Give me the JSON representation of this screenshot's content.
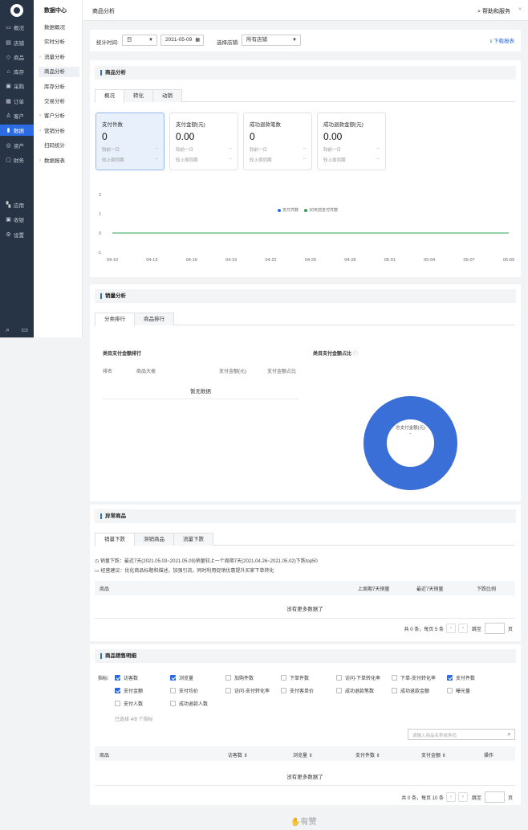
{
  "rail": {
    "items": [
      {
        "icon": "overview-icon",
        "glyph": "▭",
        "label": "概况"
      },
      {
        "icon": "store-icon",
        "glyph": "▤",
        "label": "店铺"
      },
      {
        "icon": "tag-icon",
        "glyph": "◇",
        "label": "商品"
      },
      {
        "icon": "warehouse-icon",
        "glyph": "⌂",
        "label": "库存"
      },
      {
        "icon": "purchase-icon",
        "glyph": "▣",
        "label": "采购"
      },
      {
        "icon": "order-icon",
        "glyph": "▦",
        "label": "订单"
      },
      {
        "icon": "customer-icon",
        "glyph": "♙",
        "label": "客户"
      },
      {
        "icon": "data-icon",
        "glyph": "▮",
        "label": "数据"
      },
      {
        "icon": "asset-icon",
        "glyph": "◎",
        "label": "资产"
      },
      {
        "icon": "finance-icon",
        "glyph": "▢",
        "label": "财务"
      }
    ],
    "bottom_items": [
      {
        "icon": "apps-icon",
        "glyph": "▚",
        "label": "应用"
      },
      {
        "icon": "cashier-icon",
        "glyph": "▣",
        "label": "收银"
      },
      {
        "icon": "settings-icon",
        "glyph": "⚙",
        "label": "设置"
      }
    ],
    "accent": "#2b6be5"
  },
  "subnav": {
    "head": "数据中心",
    "items": [
      "数据概况",
      "实时分析",
      "流量分析",
      "商品分析",
      "库存分析",
      "交易分析",
      "客户分析",
      "营销分析",
      "扫码统计",
      "数据报表"
    ]
  },
  "topbar": {
    "title": "商品分析",
    "help": "帮助和服务",
    "collapse": "«"
  },
  "filters": {
    "period_label": "统计时间:",
    "period_value": "日",
    "date_value": "2021-05-09",
    "store_label": "选择店铺:",
    "store_value": "所有店铺",
    "download": "下载报表"
  },
  "product_analysis": {
    "title": "商品分析",
    "tabs": [
      "概况",
      "转化",
      "动销"
    ],
    "tiles": [
      {
        "label": "支付件数",
        "value": "0",
        "cmp1": "较前一日",
        "cmp1v": "--",
        "cmp2": "较上周同期",
        "cmp2v": "--"
      },
      {
        "label": "支付金额(元)",
        "value": "0.00",
        "cmp1": "较前一日",
        "cmp1v": "--",
        "cmp2": "较上周同期",
        "cmp2v": "--"
      },
      {
        "label": "成功退款笔数",
        "value": "0",
        "cmp1": "较前一日",
        "cmp1v": "--",
        "cmp2": "较上周同期",
        "cmp2v": "--"
      },
      {
        "label": "成功退款金额(元)",
        "value": "0.00",
        "cmp1": "较前一日",
        "cmp1v": "--",
        "cmp2": "较上周同期",
        "cmp2v": "--"
      }
    ]
  },
  "chart_data": {
    "type": "line",
    "x": [
      "04-10",
      "04-13",
      "04-16",
      "04-19",
      "04-22",
      "04-25",
      "04-28",
      "05-01",
      "05-04",
      "05-07",
      "05-09"
    ],
    "series": [
      {
        "name": "支付件数",
        "color": "#2b6be5",
        "values": [
          0,
          0,
          0,
          0,
          0,
          0,
          0,
          0,
          0,
          0,
          0
        ]
      },
      {
        "name": "30天前支付件数",
        "color": "#2da44e",
        "values": [
          0,
          0,
          0,
          0,
          0,
          0,
          0,
          0,
          0,
          0,
          0
        ]
      }
    ],
    "yticks": [
      2,
      1,
      0,
      -1
    ],
    "ylim": [
      -1,
      2
    ],
    "grid": false,
    "legend": "top"
  },
  "sales_analysis": {
    "title": "销量分析",
    "tabs": [
      "分类排行",
      "商品排行"
    ],
    "rank_title": "类目支付金额排行",
    "rank_headers": [
      "排名",
      "商品大类",
      "支付金额(元)",
      "支付金额占比"
    ],
    "rank_empty": "暂无数据",
    "share_title": "类目支付金额占比",
    "share_info_icon": "info-icon",
    "donut_label": "总支付金额(元)",
    "donut_value": "-",
    "donut_color": "#3b6fd8"
  },
  "abnormal": {
    "title": "异常商品",
    "tabs": [
      "销量下跌",
      "滞销商品",
      "流量下跌"
    ],
    "note1": "销量下跌：最近7天(2021.05.03~2021.05.09)销量较上一个周期7天(2021.04.26~2021.05.02)下跌top50",
    "note2": "经营建议：优化商品标题和描述，加强引流，同时利用促销优惠提升买家下单转化",
    "headers": [
      "商品",
      "上周期7天销量",
      "最近7天销量",
      "下跌比例"
    ],
    "empty": "没有更多数据了",
    "pager": {
      "summary": "共 0 条，每页 5 条",
      "goto": "跳至",
      "page_unit": "页",
      "prev": "‹",
      "next": "›"
    }
  },
  "detail": {
    "title": "商品销售明细",
    "metric_label": "指标:",
    "metrics": [
      {
        "label": "访客数",
        "checked": true
      },
      {
        "label": "浏览量",
        "checked": true
      },
      {
        "label": "加购件数",
        "checked": false
      },
      {
        "label": "下单件数",
        "checked": false
      },
      {
        "label": "访问-下单转化率",
        "checked": false
      },
      {
        "label": "下单-支付转化率",
        "checked": false
      },
      {
        "label": "支付件数",
        "checked": true
      },
      {
        "label": "支付金额",
        "checked": true
      },
      {
        "label": "支付均价",
        "checked": false
      },
      {
        "label": "访问-支付转化率",
        "checked": false
      },
      {
        "label": "支付客单价",
        "checked": false
      },
      {
        "label": "成功退款笔数",
        "checked": false
      },
      {
        "label": "成功退款金额",
        "checked": false
      },
      {
        "label": "曝光量",
        "checked": false
      },
      {
        "label": "支付人数",
        "checked": false
      },
      {
        "label": "成功退款人数",
        "checked": false
      }
    ],
    "selected_text": "已选择 4/8 个指标",
    "search_placeholder": "请输入商品名称或条码",
    "headers": [
      "商品",
      "访客数 ⇕",
      "浏览量 ⇕",
      "支付件数 ⇕",
      "支付金额 ⇕",
      "操作"
    ],
    "empty": "没有更多数据了",
    "pager": {
      "summary": "共 0 条，每页 10 条",
      "goto": "跳至",
      "page_unit": "页",
      "prev": "‹",
      "next": "›"
    }
  },
  "watermark": "有赞"
}
